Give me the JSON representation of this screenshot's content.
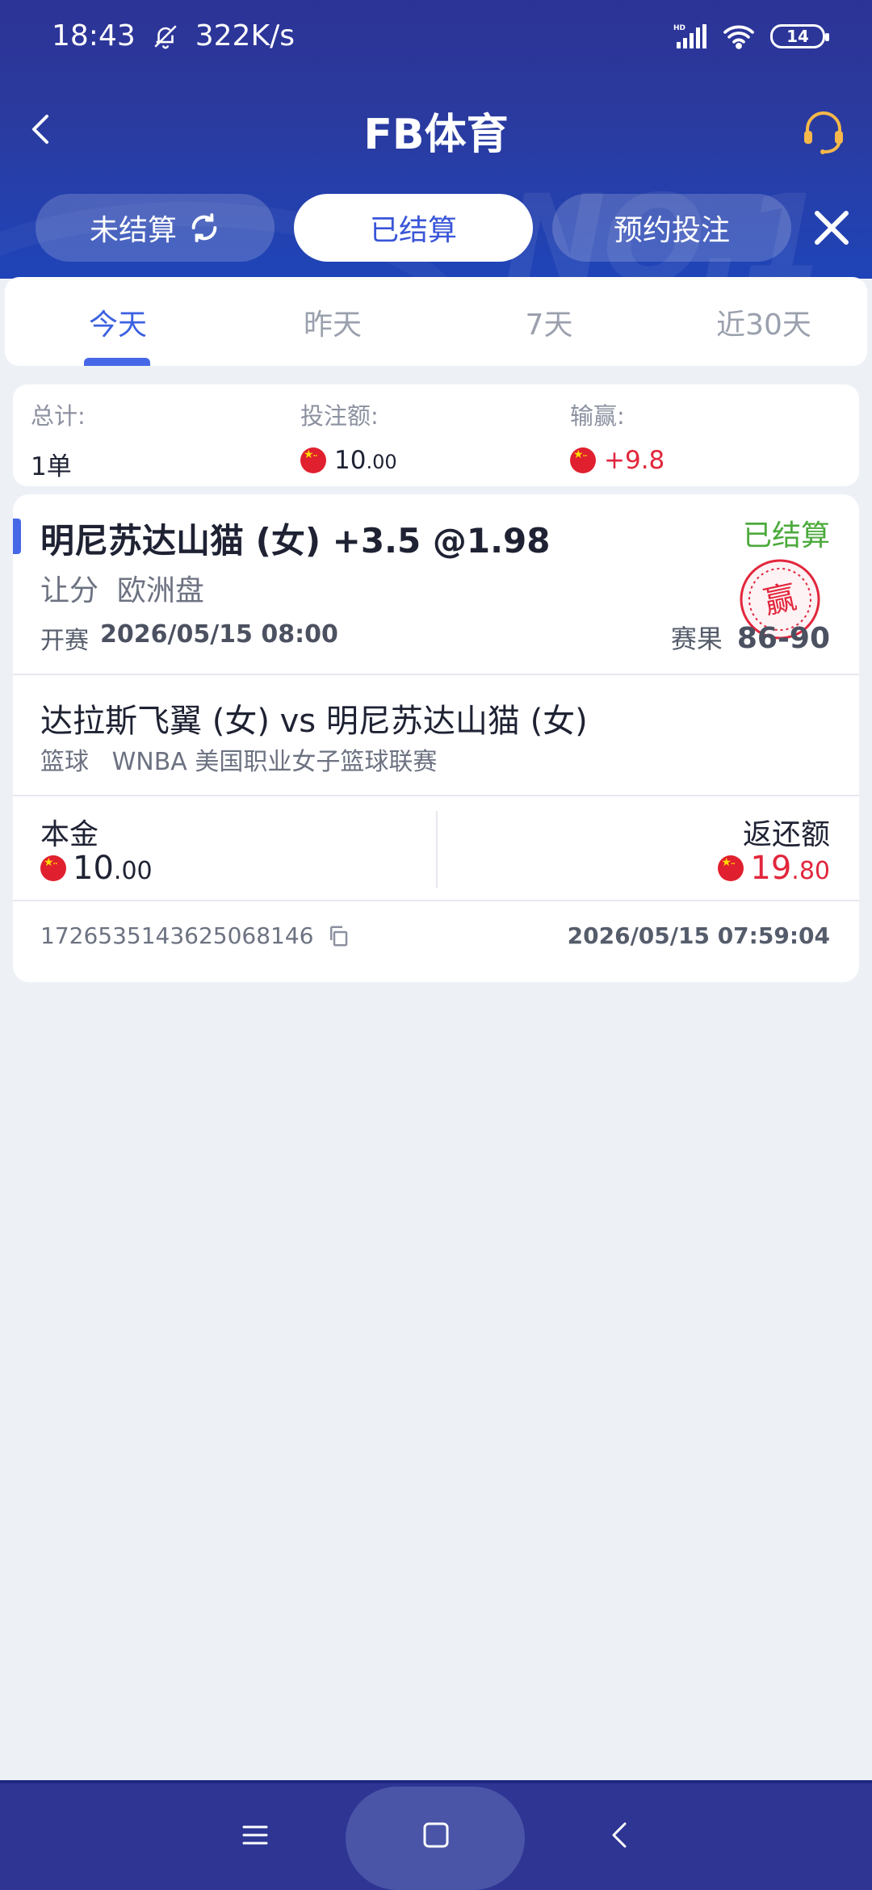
{
  "status_bar": {
    "time": "18:43",
    "speed": "322K/s",
    "battery": "14",
    "network": "HD"
  },
  "header": {
    "title": "FB体育"
  },
  "segments": [
    {
      "label": "未结算"
    },
    {
      "label": "已结算"
    },
    {
      "label": "预约投注"
    }
  ],
  "header_deco": "NO.1",
  "day_tabs": [
    "今天",
    "昨天",
    "7天",
    "近30天"
  ],
  "summary": {
    "total_label": "总计:",
    "total_value": "1单",
    "stake_label": "投注额:",
    "stake_value": "10",
    "stake_dec": ".00",
    "win_label": "输赢:",
    "win_value": "+9.8"
  },
  "bet": {
    "selection": "明尼苏达山猫 (女)",
    "handicap": "+3.5 @1.98",
    "status": "已结算",
    "type": "让分  欧洲盘",
    "stamp_text": "赢",
    "kickoff_label": "开赛",
    "kickoff_time": "2026/05/15 08:00",
    "result_label": "赛果",
    "result_score": "86-90",
    "match": "达拉斯飞翼 (女) vs 明尼苏达山猫 (女)",
    "league": "篮球   WNBA 美国职业女子篮球联赛",
    "principal_label": "本金",
    "principal_int": "10",
    "principal_dec": ".00",
    "return_label": "返还额",
    "return_int": "19",
    "return_dec": ".80",
    "order_id": "1726535143625068146",
    "order_time": "2026/05/15 07:59:04"
  },
  "colors": {
    "primary": "#2c3396",
    "accent": "#4668e6",
    "win_green": "#4caa3c",
    "loss_red": "#e2263c"
  },
  "icons": [
    "back-icon",
    "headset-icon",
    "sync-icon",
    "close-icon",
    "copy-icon",
    "menu-icon",
    "home-icon",
    "nav-back-icon",
    "mute-bell-icon",
    "signal-icon",
    "wifi-icon"
  ]
}
